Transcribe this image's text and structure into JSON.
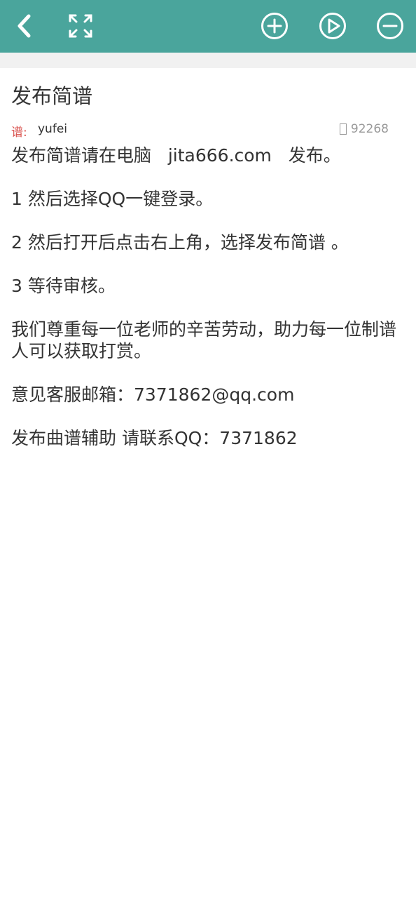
{
  "toolbar": {
    "icons": [
      "back-chevron-icon",
      "fullscreen-icon",
      "zoom-in-icon",
      "play-icon",
      "zoom-out-icon"
    ],
    "color": "#4aa59c"
  },
  "article": {
    "title": "发布简谱",
    "meta": {
      "label": "谱:",
      "author": "yufei",
      "views": "92268"
    },
    "paragraphs": [
      "发布简谱请在电脑   jita666.com   发布。",
      "1 然后选择QQ一键登录。",
      "2 然后打开后点击右上角，选择发布简谱 。",
      "3 等待审核。",
      "我们尊重每一位老师的辛苦劳动，助力每一位制谱人可以获取打赏。",
      "意见客服邮箱：7371862@qq.com",
      "发布曲谱辅助 请联系QQ：7371862"
    ]
  },
  "colors": {
    "label_red": "#d9534f",
    "text": "#333333",
    "muted": "#999999",
    "divider": "#f1f1f1"
  }
}
